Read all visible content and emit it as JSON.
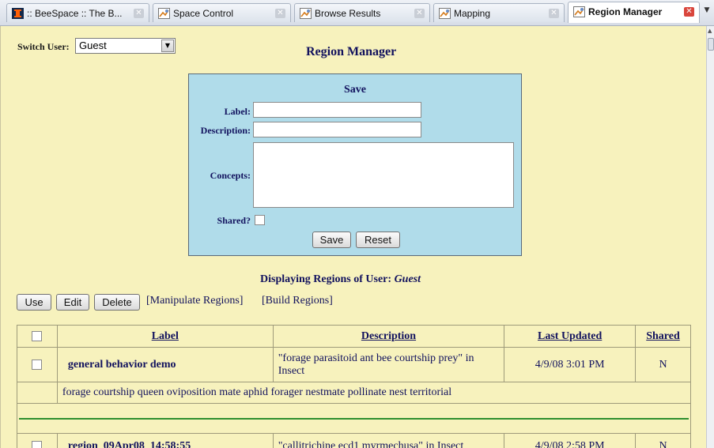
{
  "tabs": [
    {
      "title": ":: BeeSpace :: The B...",
      "icon": "site-favicon-icon",
      "active": false
    },
    {
      "title": "Space Control",
      "icon": "beespace-icon",
      "active": false
    },
    {
      "title": "Browse Results",
      "icon": "beespace-icon",
      "active": false
    },
    {
      "title": "Mapping",
      "icon": "beespace-icon",
      "active": false
    },
    {
      "title": "Region Manager",
      "icon": "beespace-icon",
      "active": true
    }
  ],
  "header": {
    "switch_user_label": "Switch User:",
    "switch_user_value": "Guest",
    "page_title": "Region Manager"
  },
  "save_form": {
    "title": "Save",
    "label_label": "Label:",
    "label_value": "",
    "description_label": "Description:",
    "description_value": "",
    "concepts_label": "Concepts:",
    "concepts_value": "",
    "shared_label": "Shared?",
    "save_button": "Save",
    "reset_button": "Reset"
  },
  "regions": {
    "heading_prefix": "Displaying Regions of User:",
    "heading_user": "Guest",
    "actions": {
      "use": "Use",
      "edit": "Edit",
      "delete": "Delete"
    },
    "links": {
      "manipulate": "[Manipulate Regions]",
      "build": "[Build Regions]"
    },
    "columns": {
      "label": "Label",
      "description": "Description",
      "last_updated": "Last Updated",
      "shared": "Shared"
    },
    "rows": [
      {
        "label": "general behavior demo",
        "description": "\"forage parasitoid ant bee courtship prey\" in Insect",
        "last_updated": "4/9/08 3:01 PM",
        "shared": "N",
        "concepts": "forage courtship queen oviposition mate aphid forager nestmate pollinate nest territorial"
      },
      {
        "label": "region_09Apr08_14:58:55",
        "description": "\"callitrichine ecd1 myrmechusa\" in Insect",
        "last_updated": "4/9/08 2:58 PM",
        "shared": "N"
      }
    ]
  },
  "colors": {
    "page_bg": "#f7f2bd",
    "form_bg": "#b0dcea",
    "text": "#12125e",
    "divider": "#2f8f2f",
    "close_active": "#d9463c"
  }
}
